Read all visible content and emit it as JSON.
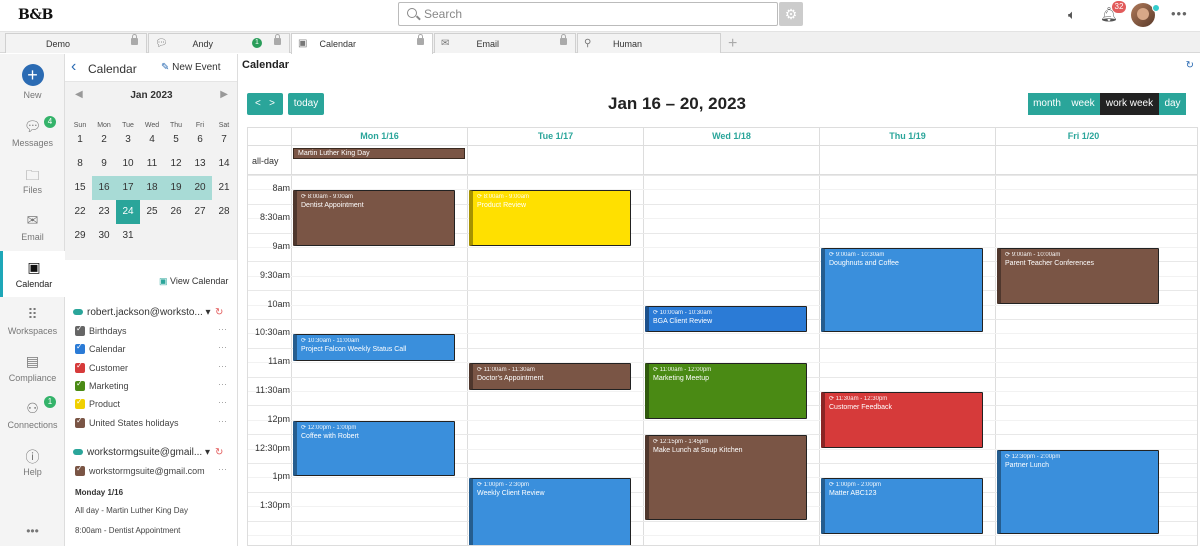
{
  "app": {
    "logo": "B&B"
  },
  "search": {
    "placeholder": "Search"
  },
  "header": {
    "notif_count": "32"
  },
  "tabs": [
    {
      "label": "Demo",
      "icon": "building-icon"
    },
    {
      "label": "Andy Richmond",
      "icon": "chat-icon",
      "badge": "1"
    },
    {
      "label": "Calendar",
      "icon": "calendar-icon"
    },
    {
      "label": "Email",
      "icon": "email-icon"
    },
    {
      "label": "Human Resourc...",
      "icon": "org-icon"
    }
  ],
  "rail": [
    {
      "label": "New"
    },
    {
      "label": "Messages",
      "badge": "4"
    },
    {
      "label": "Files"
    },
    {
      "label": "Email"
    },
    {
      "label": "Calendar"
    },
    {
      "label": "Workspaces"
    },
    {
      "label": "Compliance"
    },
    {
      "label": "Connections",
      "badge": "1"
    },
    {
      "label": "Help"
    }
  ],
  "sidebar": {
    "title": "Calendar",
    "new_event": "New Event",
    "month": "Jan 2023",
    "dow": [
      "Sun",
      "Mon",
      "Tue",
      "Wed",
      "Thu",
      "Fri",
      "Sat"
    ],
    "weeks": [
      [
        "1",
        "2",
        "3",
        "4",
        "5",
        "6",
        "7"
      ],
      [
        "8",
        "9",
        "10",
        "11",
        "12",
        "13",
        "14"
      ],
      [
        "15",
        "16",
        "17",
        "18",
        "19",
        "20",
        "21"
      ],
      [
        "22",
        "23",
        "24",
        "25",
        "26",
        "27",
        "28"
      ],
      [
        "29",
        "30",
        "31",
        "",
        "",
        "",
        ""
      ]
    ],
    "view_calendar": "View Calendar",
    "account1": "robert.jackson@worksto...",
    "calendars1": [
      {
        "label": "Birthdays",
        "color": "#666666"
      },
      {
        "label": "Calendar",
        "color": "#2b7bd6"
      },
      {
        "label": "Customer",
        "color": "#d63a3a"
      },
      {
        "label": "Marketing",
        "color": "#4a8a14"
      },
      {
        "label": "Product",
        "color": "#f0d000"
      },
      {
        "label": "United States holidays",
        "color": "#7a5545"
      }
    ],
    "account2": "workstormgsuite@gmail...",
    "calendars2": [
      {
        "label": "workstormgsuite@gmail.com",
        "color": "#7a5545"
      }
    ],
    "agenda_header": "Monday 1/16",
    "agenda": [
      "All day - Martin Luther King Day",
      "8:00am - Dentist Appointment"
    ]
  },
  "main": {
    "title": "Calendar",
    "prev": "<",
    "next": ">",
    "today": "today",
    "range": "Jan 16 – 20, 2023",
    "views": [
      "month",
      "week",
      "work week",
      "day"
    ],
    "active_view": "work week",
    "days": [
      "Mon 1/16",
      "Tue 1/17",
      "Wed 1/18",
      "Thu 1/19",
      "Fri 1/20"
    ],
    "allday_label": "all-day",
    "times": [
      "8am",
      "8:30am",
      "9am",
      "9:30am",
      "10am",
      "10:30am",
      "11am",
      "11:30am",
      "12pm",
      "12:30pm",
      "1pm",
      "1:30pm"
    ]
  },
  "allday_events": [
    {
      "day": 0,
      "name": "Martin Luther King Day",
      "color": "#7a5545"
    }
  ],
  "events": [
    {
      "day": 0,
      "start": 8.0,
      "end": 9.0,
      "time": "8:00am - 9:00am",
      "name": "Dentist Appointment",
      "color": "#7a5545"
    },
    {
      "day": 1,
      "start": 8.0,
      "end": 9.0,
      "time": "8:00am - 9:00am",
      "name": "Product Review",
      "color": "#ffe000"
    },
    {
      "day": 3,
      "start": 9.0,
      "end": 10.5,
      "time": "9:00am - 10:30am",
      "name": "Doughnuts and Coffee",
      "color": "#3a8fdc"
    },
    {
      "day": 4,
      "start": 9.0,
      "end": 10.0,
      "time": "9:00am - 10:00am",
      "name": "Parent Teacher Conferences",
      "color": "#7a5545"
    },
    {
      "day": 2,
      "start": 10.0,
      "end": 10.5,
      "time": "10:00am - 10:30am",
      "name": "BGA Client Review",
      "color": "#2b7bd6"
    },
    {
      "day": 0,
      "start": 10.5,
      "end": 11.0,
      "time": "10:30am - 11:00am",
      "name": "Project Falcon Weekly Status Call",
      "color": "#3a8fdc"
    },
    {
      "day": 1,
      "start": 11.0,
      "end": 11.5,
      "time": "11:00am - 11:30am",
      "name": "Doctor's Appointment",
      "color": "#7a5545"
    },
    {
      "day": 2,
      "start": 11.0,
      "end": 12.0,
      "time": "11:00am - 12:00pm",
      "name": "Marketing Meetup",
      "color": "#4a8a14"
    },
    {
      "day": 3,
      "start": 11.5,
      "end": 12.5,
      "time": "11:30am - 12:30pm",
      "name": "Customer Feedback",
      "color": "#d63a3a"
    },
    {
      "day": 0,
      "start": 12.0,
      "end": 13.0,
      "time": "12:00pm - 1:00pm",
      "name": "Coffee with Robert",
      "color": "#3a8fdc"
    },
    {
      "day": 2,
      "start": 12.25,
      "end": 13.75,
      "time": "12:15pm - 1:45pm",
      "name": "Make Lunch at Soup Kitchen",
      "color": "#7a5545"
    },
    {
      "day": 4,
      "start": 12.5,
      "end": 14.0,
      "time": "12:30pm - 2:00pm",
      "name": "Partner Lunch",
      "color": "#3a8fdc"
    },
    {
      "day": 1,
      "start": 13.0,
      "end": 14.5,
      "time": "1:00pm - 2:30pm",
      "name": "Weekly Client Review",
      "color": "#3a8fdc"
    },
    {
      "day": 3,
      "start": 13.0,
      "end": 14.0,
      "time": "1:00pm - 2:00pm",
      "name": "Matter ABC123",
      "color": "#3a8fdc"
    }
  ]
}
